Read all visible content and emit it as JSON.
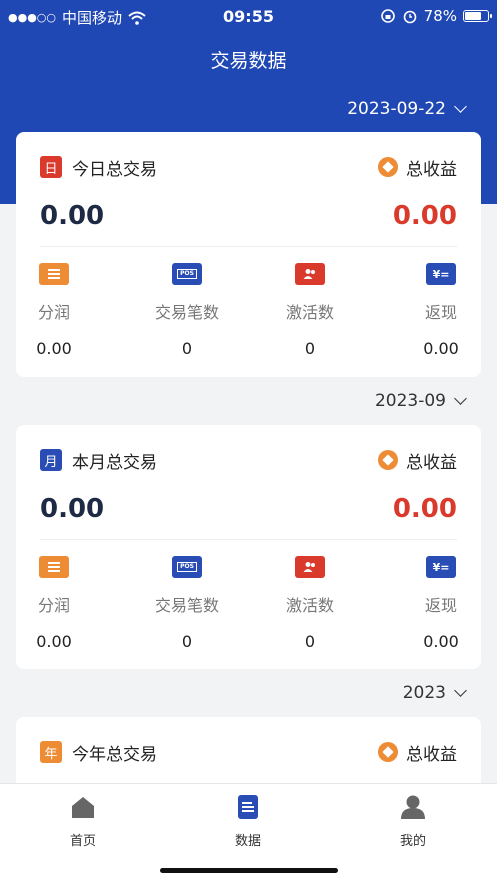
{
  "status_bar": {
    "signal": "●●●○○",
    "carrier": "中国移动",
    "time": "09:55",
    "battery": "78%",
    "battery_level": 0.78
  },
  "page": {
    "title": "交易数据"
  },
  "colors": {
    "brand_blue": "#2048b4",
    "orange": "#ee8b35",
    "red": "#d93a2b",
    "navy": "#2a4db5"
  },
  "stat_icons": [
    "list-icon",
    "pos-icon",
    "activation-icon",
    "cashback-icon"
  ],
  "sections": [
    {
      "date": "2023-09-22",
      "badge": "日",
      "title": "今日总交易",
      "total_amount": "0.00",
      "income_label": "总收益",
      "income_amount": "0.00",
      "stats": [
        {
          "label": "分润",
          "value": "0.00"
        },
        {
          "label": "交易笔数",
          "value": "0"
        },
        {
          "label": "激活数",
          "value": "0"
        },
        {
          "label": "返现",
          "value": "0.00"
        }
      ]
    },
    {
      "date": "2023-09",
      "badge": "月",
      "title": "本月总交易",
      "total_amount": "0.00",
      "income_label": "总收益",
      "income_amount": "0.00",
      "stats": [
        {
          "label": "分润",
          "value": "0.00"
        },
        {
          "label": "交易笔数",
          "value": "0"
        },
        {
          "label": "激活数",
          "value": "0"
        },
        {
          "label": "返现",
          "value": "0.00"
        }
      ]
    },
    {
      "date": "2023",
      "badge": "年",
      "title": "今年总交易",
      "income_label": "总收益"
    }
  ],
  "tabbar": [
    {
      "label": "首页",
      "icon": "home-icon",
      "active": false
    },
    {
      "label": "数据",
      "icon": "data-icon",
      "active": true
    },
    {
      "label": "我的",
      "icon": "profile-icon",
      "active": false
    }
  ]
}
